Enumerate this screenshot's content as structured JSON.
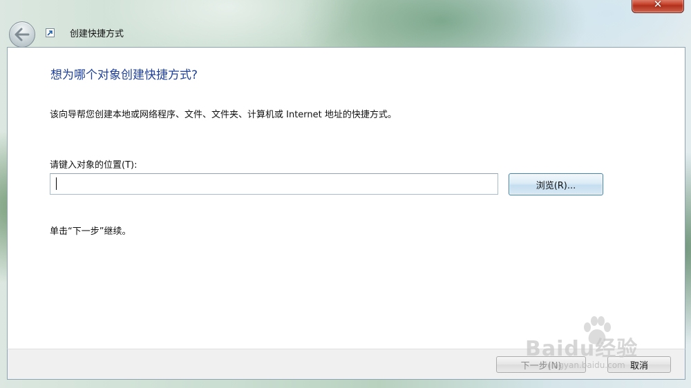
{
  "window": {
    "title": "创建快捷方式",
    "close_label": "✕"
  },
  "main": {
    "heading": "想为哪个对象创建快捷方式?",
    "description": "该向导帮您创建本地或网络程序、文件、文件夹、计算机或 Internet 地址的快捷方式。",
    "location_label": "请键入对象的位置(T):",
    "location_value": "",
    "browse_label": "浏览(R)...",
    "hint": "单击“下一步”继续。"
  },
  "footer": {
    "next_label": "下一步(N)",
    "cancel_label": "取消"
  },
  "watermark": {
    "brand": "Baidu经验",
    "url": "jingyan.baidu.com"
  },
  "icons": [
    "back-arrow-icon",
    "shortcut-icon",
    "close-icon"
  ],
  "colors": {
    "heading": "#1e3f9a",
    "close_button": "#c8452e",
    "browse_border": "#3c7fb1"
  }
}
